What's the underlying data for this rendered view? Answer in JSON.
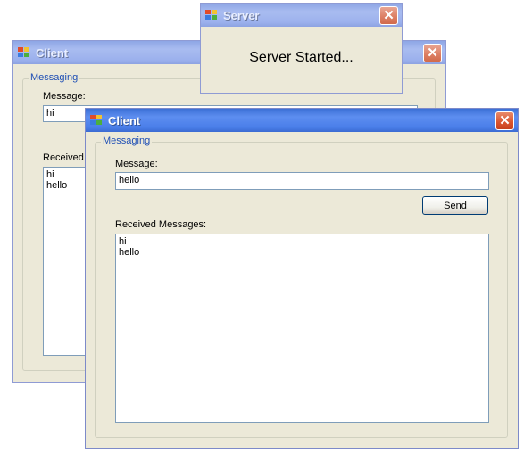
{
  "client_back": {
    "title": "Client",
    "close_glyph": "✕",
    "group_label": "Messaging",
    "message_label": "Message:",
    "message_value": "hi",
    "received_label": "Received",
    "received_items": [
      "hi",
      "hello"
    ]
  },
  "server": {
    "title": "Server",
    "close_glyph": "✕",
    "status_text": "Server Started..."
  },
  "client_front": {
    "title": "Client",
    "close_glyph": "✕",
    "group_label": "Messaging",
    "message_label": "Message:",
    "message_value": "hello",
    "send_label": "Send",
    "received_label": "Received Messages:",
    "received_items": [
      "hi",
      "hello"
    ]
  },
  "icons": {
    "app_icon": "windows-app-icon",
    "close_icon": "close-icon"
  },
  "colors": {
    "titlebar_active": "#4a7ee9",
    "titlebar_inactive": "#9cb1ed",
    "close_button": "#d9532e",
    "window_body": "#ece9d8",
    "group_label": "#1f4fb5"
  }
}
